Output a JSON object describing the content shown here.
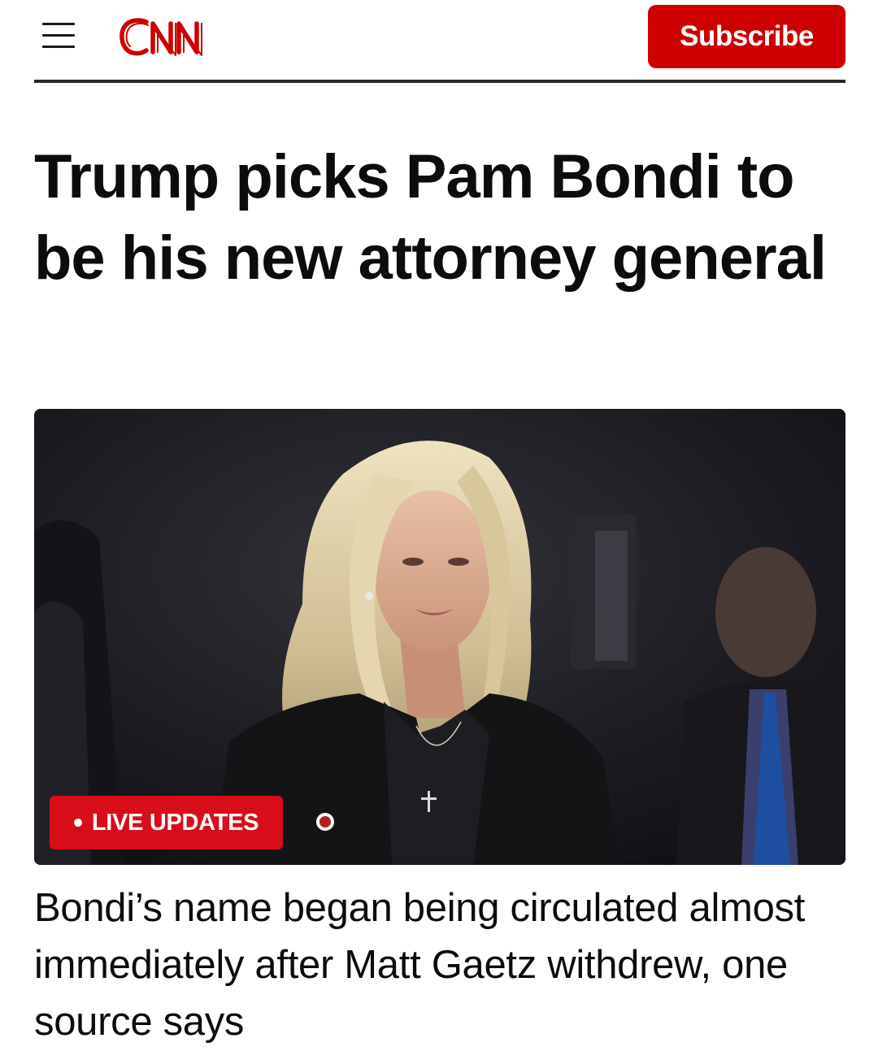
{
  "header": {
    "logo_text": "CNN",
    "menu_icon": "hamburger-menu-icon",
    "subscribe_label": "Subscribe",
    "brand_color": "#cc0000"
  },
  "article": {
    "headline": "Trump picks Pam Bondi to be his new attorney general",
    "hero_image": {
      "live_badge_label": "LIVE UPDATES",
      "live_badge_color": "#d80d1a"
    },
    "caption": "Bondi’s name began being circulated almost immediately after Matt Gaetz withdrew, one source says"
  }
}
